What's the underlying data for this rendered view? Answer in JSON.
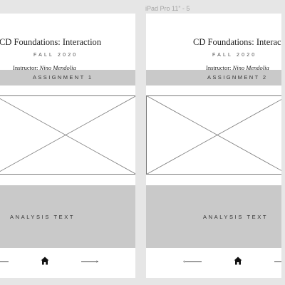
{
  "frame_label": "iPad Pro 11” - 5",
  "artboards": [
    {
      "course_title": "CD Foundations: Interaction",
      "term": "FALL 2020",
      "instructor_prefix": "Instructor:",
      "instructor_name": "Nino Mendolia",
      "assignment_label": "ASSIGNMENT 1",
      "analysis_label": "ANALYSIS TEXT",
      "nav": {
        "left": "prev-arrow",
        "center": "home-icon",
        "right": "next-arrow"
      }
    },
    {
      "course_title": "CD Foundations: Interaction",
      "term": "FALL 2020",
      "instructor_prefix": "Instructor:",
      "instructor_name": "Nino Mendolia",
      "assignment_label": "ASSIGNMENT 2",
      "analysis_label": "ANALYSIS TEXT",
      "nav": {
        "left": "prev-arrow",
        "center": "home-icon",
        "right": "next-arrow"
      }
    }
  ],
  "colors": {
    "canvas": "#e6e6e6",
    "artboard": "#ffffff",
    "bar": "#c9c9c9",
    "text": "#1f1f1f"
  }
}
